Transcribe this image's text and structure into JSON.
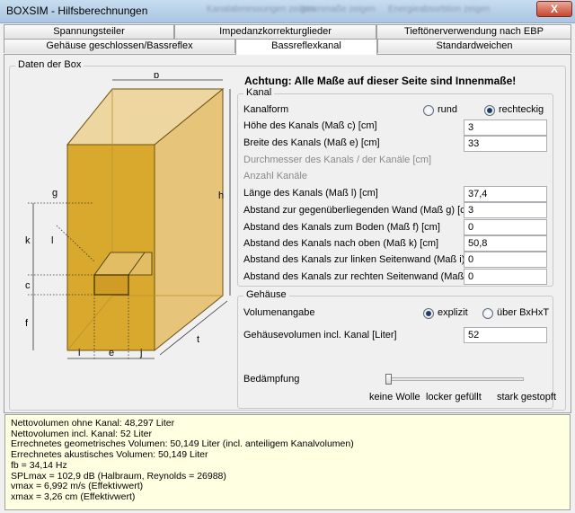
{
  "window": {
    "title": "BOXSIM - Hilfsberechnungen",
    "blurred_menu": [
      "Kanalabmessungen zeigen",
      "Innenmaße zeigen",
      "Energieabsorbtion zeigen"
    ],
    "close_label": "X"
  },
  "tabs": {
    "row1": [
      "Spannungsteiler",
      "Impedanzkorrekturglieder",
      "Tieftönerverwendung nach EBP"
    ],
    "row2": [
      "Gehäuse geschlossen/Bassreflex",
      "Bassreflexkanal",
      "Standardweichen"
    ],
    "active": "Bassreflexkanal"
  },
  "box_group": {
    "label": "Daten der Box",
    "dims": {
      "b": "b",
      "h": "h",
      "t": "t",
      "g": "g",
      "l": "l",
      "k": "k",
      "c": "c",
      "f": "f",
      "i": "i",
      "e": "e",
      "j": "j"
    }
  },
  "warning": "Achtung: Alle Maße auf dieser Seite sind Innenmaße!",
  "kanal": {
    "label": "Kanal",
    "form_label": "Kanalform",
    "option_round": "rund",
    "option_rect": "rechteckig",
    "selected": "rechteckig",
    "fields": [
      {
        "label": "Höhe des Kanals (Maß c) [cm]",
        "value": "3",
        "enabled": true
      },
      {
        "label": "Breite des Kanals (Maß e) [cm]",
        "value": "33",
        "enabled": true
      },
      {
        "label": "Durchmesser des Kanals / der Kanäle [cm]",
        "value": "",
        "enabled": false
      },
      {
        "label": "Anzahl Kanäle",
        "value": "",
        "enabled": false
      },
      {
        "label": "Länge des Kanals (Maß l) [cm]",
        "value": "37,4",
        "enabled": true
      },
      {
        "label": "Abstand zur gegenüberliegenden Wand (Maß g) [cm]",
        "value": "3",
        "enabled": true
      },
      {
        "label": "Abstand des Kanals zum Boden (Maß f) [cm]",
        "value": "0",
        "enabled": true
      },
      {
        "label": "Abstand des Kanals nach oben (Maß k) [cm]",
        "value": "50,8",
        "enabled": true
      },
      {
        "label": "Abstand des Kanals zur linken Seitenwand (Maß i) [cm]",
        "value": "0",
        "enabled": true
      },
      {
        "label": "Abstand des Kanals zur rechten Seitenwand (Maß j) [cm]",
        "value": "0",
        "enabled": true
      }
    ]
  },
  "gehaeuse": {
    "label": "Gehäuse",
    "vol_label": "Volumenangabe",
    "option_explicit": "explizit",
    "option_bxhxt": "über BxHxT",
    "selected": "explizit",
    "volume_label": "Gehäusevolumen incl. Kanal [Liter]",
    "volume_value": "52",
    "damping_label": "Bedämpfung",
    "damping_level": 0,
    "damping_ticks": [
      "keine Wolle",
      "locker gefüllt",
      "stark gestopft"
    ]
  },
  "results": [
    "Nettovolumen ohne Kanal: 48,297 Liter",
    "Nettovolumen incl. Kanal: 52 Liter",
    "Errechnetes geometrisches Volumen: 50,149 Liter (incl. anteiligem Kanalvolumen)",
    "Errechnetes akustisches Volumen: 50,149 Liter",
    "fb = 34,14 Hz",
    "SPLmax = 102,9 dB (Halbraum, Reynolds = 26988)",
    "vmax = 6,992 m/s (Effektivwert)",
    "xmax = 3,26 cm (Effektivwert)"
  ],
  "colors": {
    "box_front": "#d9a92e",
    "box_side": "#e6c47a",
    "box_top": "#eed6a0",
    "results_bg": "#ffffe1"
  }
}
